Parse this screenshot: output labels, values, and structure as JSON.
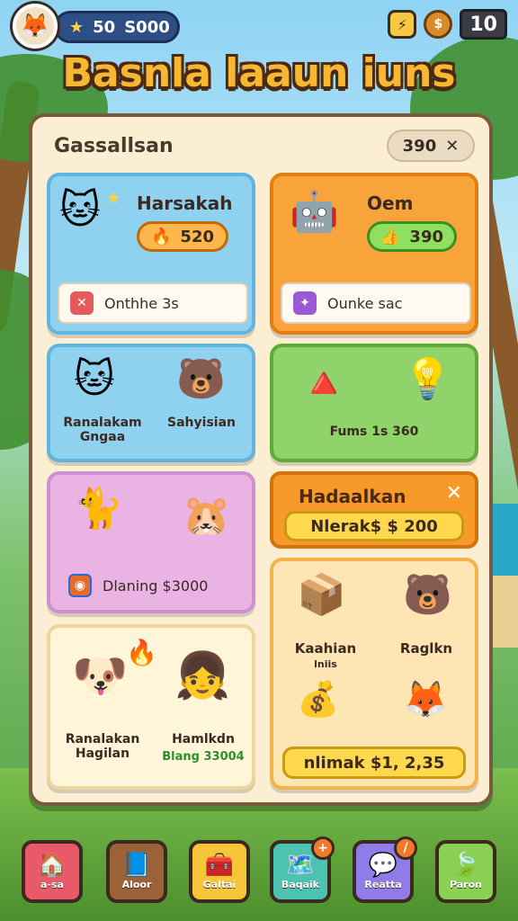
{
  "hud": {
    "avatar_icon": "fox-face-icon",
    "currency_star_value": "50",
    "currency_coin_value": "S000",
    "counter_value": "10"
  },
  "title": "Basnla laaun iuns",
  "panel": {
    "title": "Gassallsan",
    "badge_value": "390"
  },
  "cards": {
    "card1": {
      "name": "Harsakah",
      "pill_value": "520",
      "info_text": "Onthhe 3s"
    },
    "card2": {
      "name": "Oem",
      "pill_value": "390",
      "info_text": "Ounke sac"
    },
    "card3": {
      "label_left": "Ranalakam Gngaa",
      "label_right": "Sahyisian"
    },
    "card4": {
      "label": "Fums 1s 360"
    },
    "card5": {
      "info_text": "Dlaning $3000"
    },
    "header": {
      "title": "Hadaalkan",
      "pill_value": "Nlerak$ $ 200"
    },
    "card6": {
      "label_left": "Ranalakan Hagilan",
      "label_right_top": "Hamlkdn",
      "label_right_bottom": "Blang 33004"
    },
    "card7": {
      "label_a": "Kaahian",
      "label_a_sub": "lniis",
      "label_b": "Raglkn",
      "bottom_pill": "nlimak $1, 2,35"
    }
  },
  "nav": [
    {
      "label": "a-sa",
      "color": "#e85a6a"
    },
    {
      "label": "Aloor",
      "color": "#9a6236"
    },
    {
      "label": "Galtai",
      "color": "#f6c638"
    },
    {
      "label": "Baqaik",
      "color": "#4cc3b0",
      "badge": "+"
    },
    {
      "label": "Reatta",
      "color": "#8f7ce8",
      "badge": "/"
    },
    {
      "label": "Paron",
      "color": "#8ad055"
    }
  ]
}
